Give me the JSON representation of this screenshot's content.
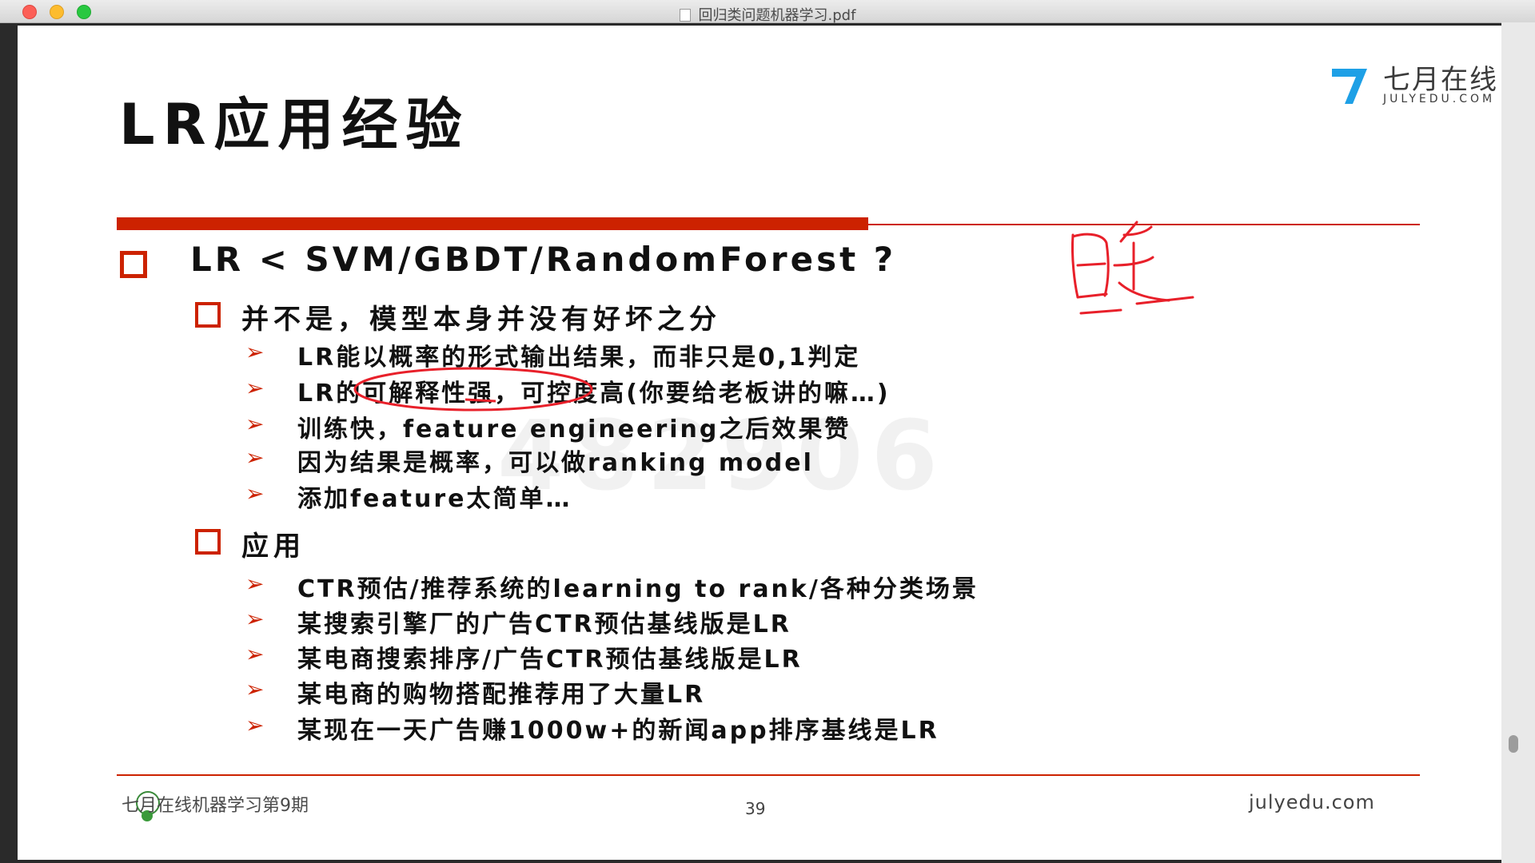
{
  "window": {
    "title": "回归类问题机器学习.pdf"
  },
  "logo": {
    "cn": "七月在线",
    "en": "JULYEDU.COM"
  },
  "slide": {
    "title": "LR应用经验",
    "main_bullet": "LR < SVM/GBDT/RandomForest ?",
    "section1": {
      "heading": "并不是，模型本身并没有好坏之分",
      "items": [
        "LR能以概率的形式输出结果，而非只是0,1判定",
        "LR的可解释性强，可控度高(你要给老板讲的嘛…)",
        "训练快，feature engineering之后效果赞",
        "因为结果是概率，可以做ranking model",
        "添加feature太简单…"
      ]
    },
    "section2": {
      "heading": "应用",
      "items": [
        "CTR预估/推荐系统的learning to rank/各种分类场景",
        "某搜索引擎厂的广告CTR预估基线版是LR",
        "某电商搜索排序/广告CTR预估基线版是LR",
        "某电商的购物搭配推荐用了大量LR",
        "某现在一天广告赚1000w+的新闻app排序基线是LR"
      ]
    },
    "watermark": "482906",
    "footer": {
      "left": "七月在线机器学习第9期",
      "page": "39",
      "right": "julyedu.com"
    }
  },
  "colors": {
    "accent": "#cc2200",
    "annotation": "#e8202a"
  }
}
